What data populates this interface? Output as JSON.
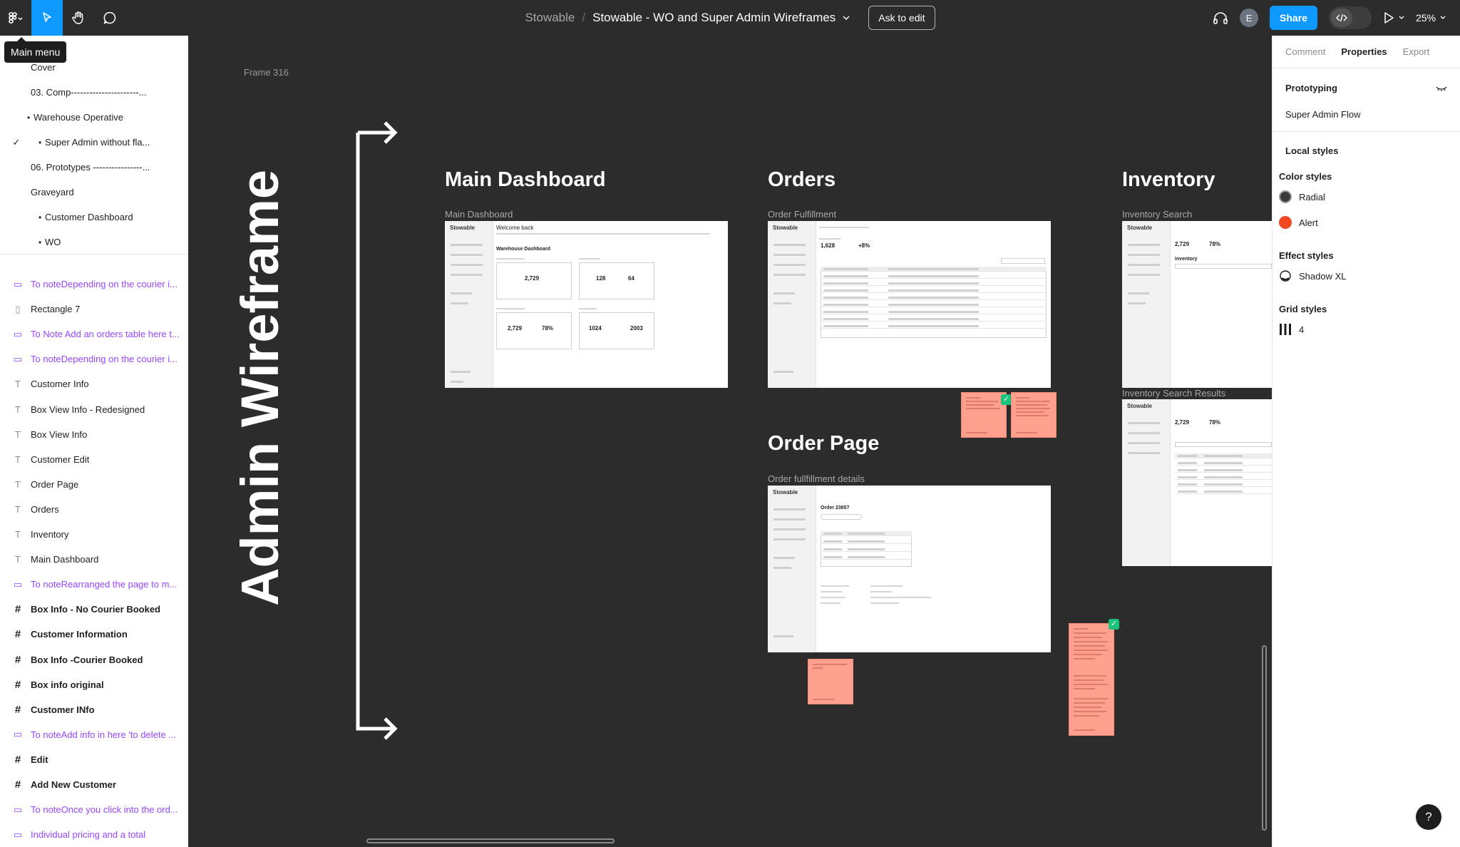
{
  "toolbar": {
    "team": "Stowable",
    "separator": "/",
    "file_name": "Stowable - WO and Super Admin Wireframes",
    "ask_to_edit": "Ask to edit",
    "avatar_initial": "E",
    "share": "Share",
    "zoom": "25%",
    "tooltip": "Main menu"
  },
  "layers": {
    "pages": [
      {
        "label": "Cover",
        "indent": 1
      },
      {
        "label": "03.  Comp----------------------..."
      },
      {
        "label": "Warehouse Operative",
        "bullet": true
      },
      {
        "label": "Super Admin without fla...",
        "bullet": true,
        "checked": true
      },
      {
        "label": "06.  Prototypes ----------------..."
      },
      {
        "label": "Graveyard"
      },
      {
        "label": "Customer Dashboard",
        "bullet": true
      },
      {
        "label": "WO",
        "bullet": true
      }
    ],
    "items": [
      {
        "type": "note",
        "label": "To noteDepending on the courier i..."
      },
      {
        "type": "rect",
        "label": "Rectangle 7"
      },
      {
        "type": "note",
        "label": "To Note Add an orders table here t..."
      },
      {
        "type": "note",
        "label": "To noteDepending on the courier i..."
      },
      {
        "type": "text",
        "label": "Customer Info"
      },
      {
        "type": "text",
        "label": "Box View Info - Redesigned"
      },
      {
        "type": "text",
        "label": "Box View Info"
      },
      {
        "type": "text",
        "label": "Customer Edit"
      },
      {
        "type": "text",
        "label": "Order Page"
      },
      {
        "type": "text",
        "label": "Orders"
      },
      {
        "type": "text",
        "label": "Inventory"
      },
      {
        "type": "text",
        "label": "Main Dashboard"
      },
      {
        "type": "note",
        "label": "To noteRearranged the page to m..."
      },
      {
        "type": "frame",
        "label": "Box Info - No Courier Booked"
      },
      {
        "type": "frame",
        "label": "Customer Information"
      },
      {
        "type": "frame",
        "label": "Box Info -Courier Booked"
      },
      {
        "type": "frame",
        "label": "Box info original"
      },
      {
        "type": "frame",
        "label": "Customer INfo"
      },
      {
        "type": "note",
        "label": "To noteAdd info in here 'to delete ..."
      },
      {
        "type": "frame",
        "label": "Edit"
      },
      {
        "type": "frame",
        "label": "Add New Customer"
      },
      {
        "type": "note",
        "label": "To noteOnce you click into the ord..."
      },
      {
        "type": "note",
        "label": "Individual pricing and a total"
      },
      {
        "type": "frame",
        "label": "Order fullfillment details"
      }
    ]
  },
  "right_panel": {
    "tabs": [
      "Comment",
      "Properties",
      "Export"
    ],
    "prototyping_title": "Prototyping",
    "flow_name": "Super Admin Flow",
    "local_styles": "Local styles",
    "color_styles_title": "Color styles",
    "color_styles": [
      {
        "name": "Radial",
        "color": "#3a3a3a"
      },
      {
        "name": "Alert",
        "color": "#f24822"
      }
    ],
    "effect_styles_title": "Effect styles",
    "effect_styles": [
      {
        "name": "Shadow XL"
      }
    ],
    "grid_styles_title": "Grid styles",
    "grid_styles": [
      {
        "name": "4"
      }
    ]
  },
  "canvas": {
    "frame_name": "Frame 316",
    "vertical_title": "Admin Wireframe",
    "sections": {
      "main_dashboard": {
        "title": "Main Dashboard",
        "frame": "Main Dashboard"
      },
      "orders": {
        "title": "Orders",
        "frame": "Order Fulfillment"
      },
      "inventory": {
        "title": "Inventory",
        "frame": "Inventory Search",
        "frame2": "Inventory Search Results"
      },
      "order_page": {
        "title": "Order Page",
        "frame": "Order fullfillment details"
      }
    },
    "wireframe": {
      "brand": "Stowable",
      "welcome": "Welcome back",
      "warehouse_dashboard": "Warehouse Dashboard",
      "stats": [
        "2,729",
        "128",
        "64",
        "2,729",
        "78%",
        "1024",
        "2003"
      ],
      "orders_stats": [
        "1,628",
        "+8%"
      ],
      "inventory_stat": [
        "2,729",
        "78%"
      ],
      "order_id": "Order 23857",
      "inventory_label": "Inventory"
    }
  },
  "colors": {
    "canvas_bg": "#2c2c2c",
    "accent": "#0d99ff",
    "note_purple": "#9747ff",
    "sticky": "#ffa08e",
    "check_green": "#1bc47d"
  }
}
